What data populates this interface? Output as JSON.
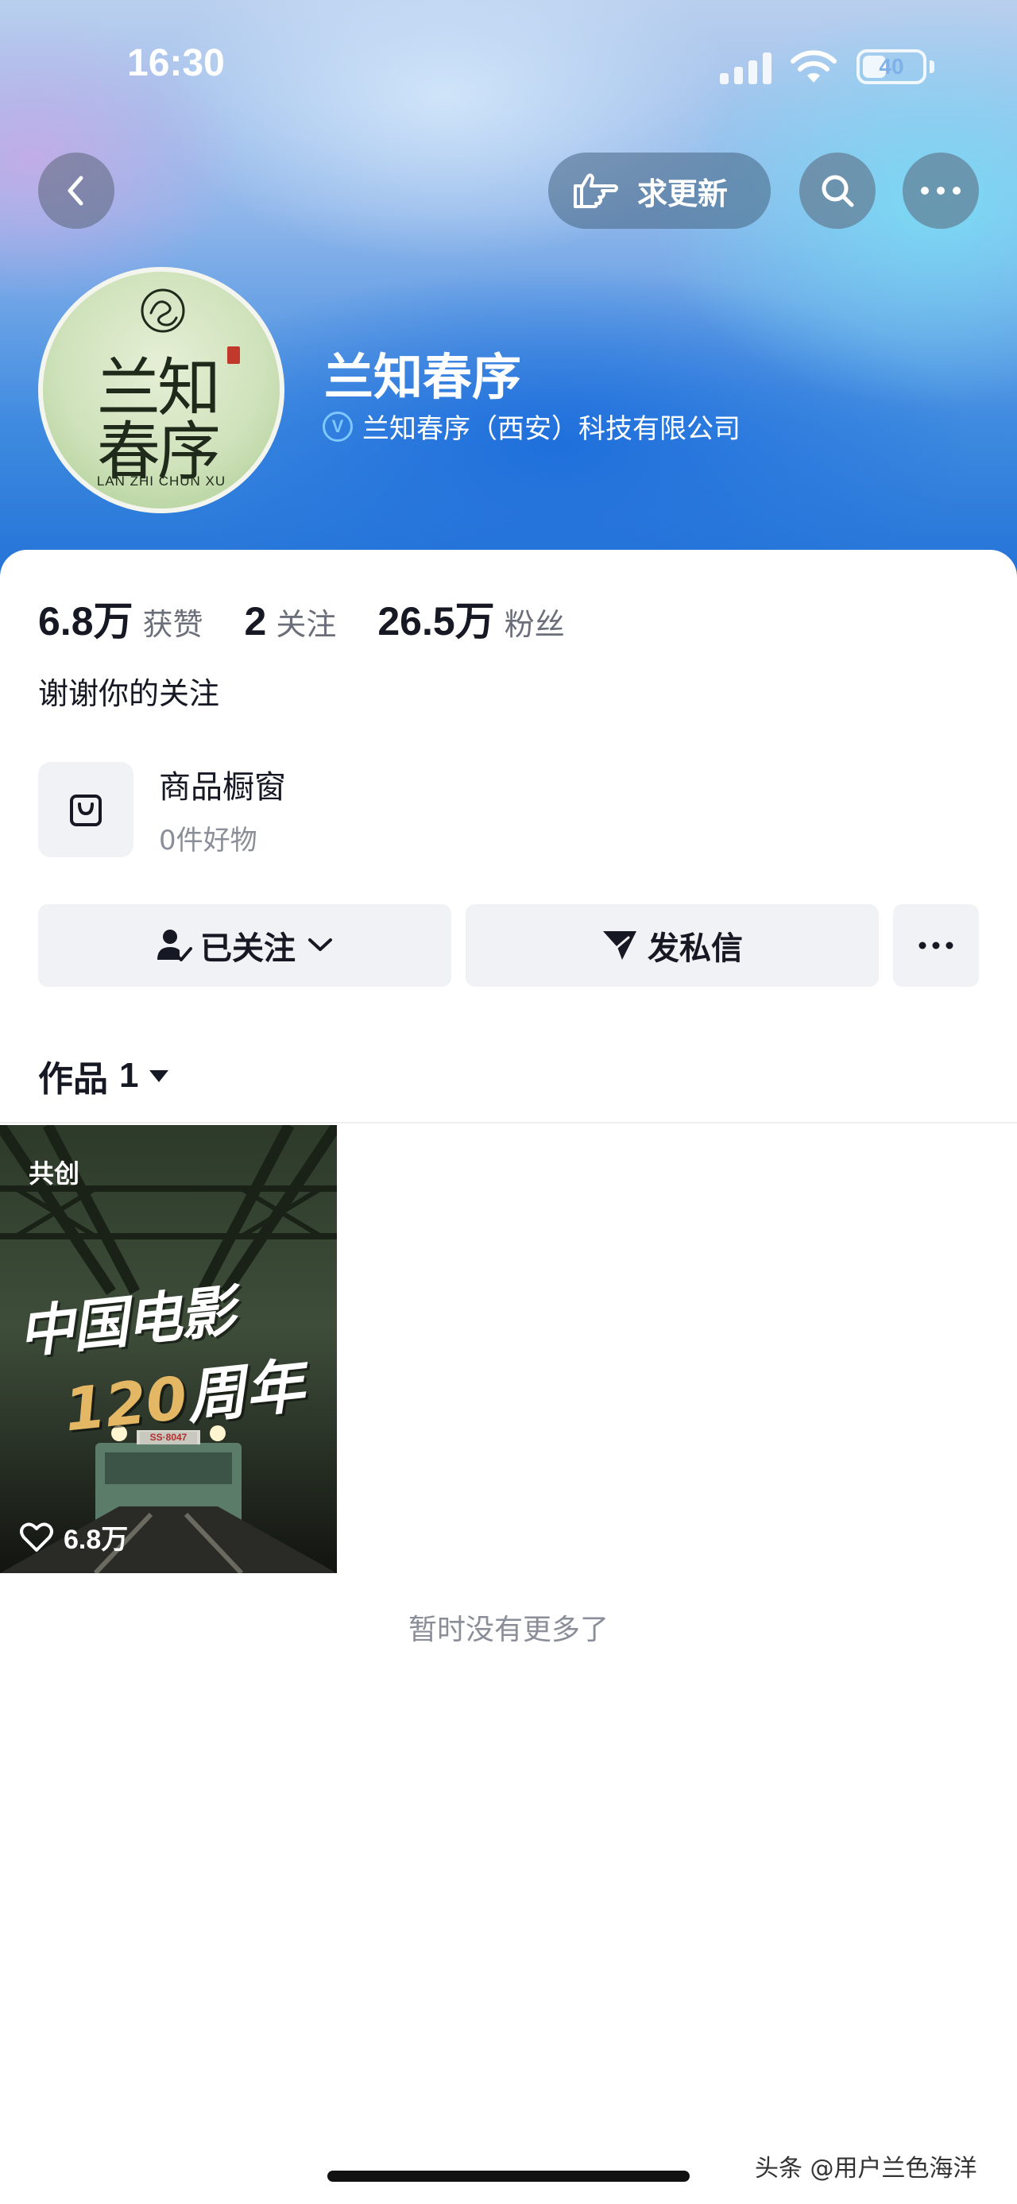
{
  "status_bar": {
    "time": "16:30",
    "battery": "40",
    "battery_level": 0.4
  },
  "top_nav": {
    "back_icon": "chevron-left-icon",
    "request_update_label": "求更新",
    "request_update_icon": "pointing-hand-icon",
    "search_icon": "search-icon",
    "more_icon": "more-dots-icon"
  },
  "profile": {
    "avatar_text_line1": "兰知",
    "avatar_text_line2": "春序",
    "avatar_subtitle": "LAN ZHI CHUN XU",
    "name": "兰知春序",
    "verified_badge": "V",
    "verified_name": "兰知春序（西安）科技有限公司"
  },
  "stats": [
    {
      "value": "6.8万",
      "label": "获赞"
    },
    {
      "value": "2",
      "label": "关注"
    },
    {
      "value": "26.5万",
      "label": "粉丝"
    }
  ],
  "bio": "谢谢你的关注",
  "shop": {
    "icon": "shopping-bag-icon",
    "title": "商品橱窗",
    "subtitle": "0件好物"
  },
  "actions": {
    "followed_label": "已关注",
    "message_label": "发私信"
  },
  "works_tab": {
    "label": "作品",
    "count": "1"
  },
  "videos": [
    {
      "tag": "共创",
      "title_line1": "中国电影",
      "title_num": "120",
      "title_line2": "周年",
      "likes": "6.8万",
      "plate": "SS·8047"
    }
  ],
  "no_more_text": "暂时没有更多了",
  "watermark": "头条 @用户兰色海洋",
  "colors": {
    "accent_blue": "#1f6fd6",
    "verified_blue": "#7ec8ff",
    "button_gray": "#f1f2f5"
  }
}
